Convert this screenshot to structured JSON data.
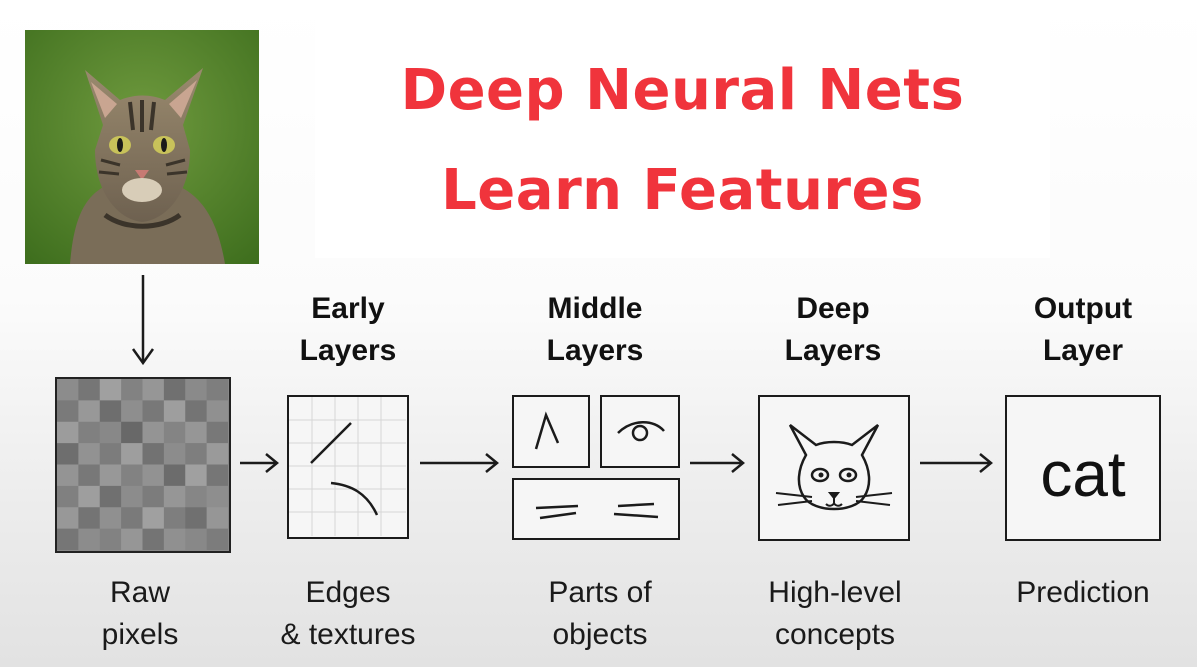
{
  "title": {
    "line1": "Deep Neural Nets",
    "line2": "Learn Features"
  },
  "stages": [
    {
      "heading": "",
      "caption_line1": "Raw",
      "caption_line2": "pixels"
    },
    {
      "heading_line1": "Early",
      "heading_line2": "Layers",
      "caption_line1": "Edges",
      "caption_line2": "& textures"
    },
    {
      "heading_line1": "Middle",
      "heading_line2": "Layers",
      "caption_line1": "Parts of",
      "caption_line2": "objects"
    },
    {
      "heading_line1": "Deep",
      "heading_line2": "Layers",
      "caption_line1": "High-level",
      "caption_line2": "concepts"
    },
    {
      "heading_line1": "Output",
      "heading_line2": "Layer",
      "caption_line1": "Prediction",
      "caption_line2": ""
    }
  ],
  "output_label": "cat",
  "colors": {
    "title": "#f0343c",
    "stroke": "#1b1b1b"
  },
  "icons": [
    "cat-photo",
    "pixel-grid-icon",
    "edges-icon",
    "parts-icon",
    "cat-face-icon"
  ]
}
